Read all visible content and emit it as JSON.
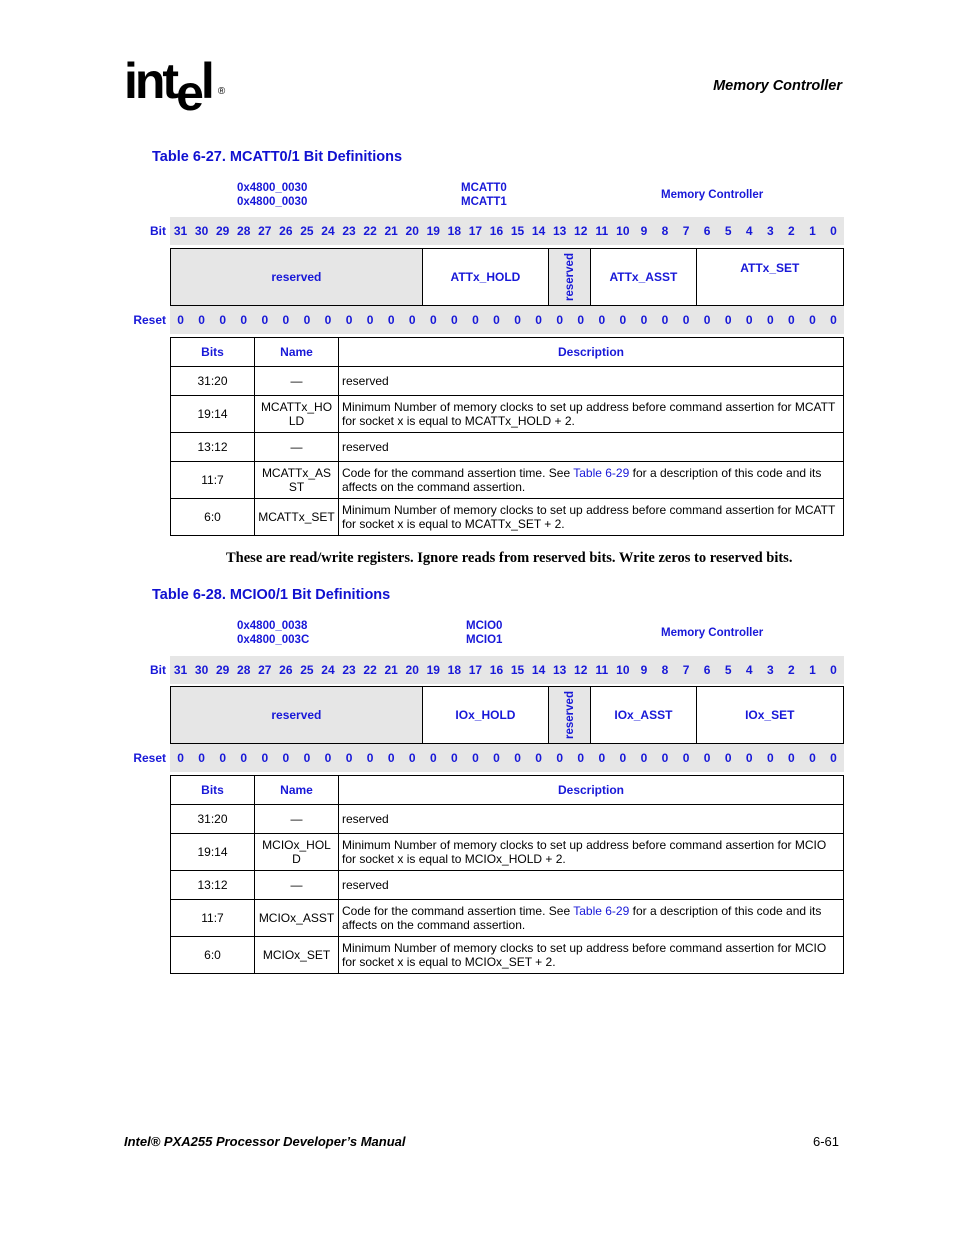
{
  "header": {
    "logo_text": "int",
    "logo_e": "e",
    "logo_l": "l",
    "logo_reg": "®",
    "section": "Memory Controller"
  },
  "tables": [
    {
      "title": "Table 6-27. MCATT0/1 Bit Definitions",
      "addresses": [
        "0x4800_0030",
        "0x4800_0030"
      ],
      "registers": [
        "MCATT0",
        "MCATT1"
      ],
      "unit": "Memory Controller",
      "bit_label": "Bit",
      "reset_label": "Reset",
      "bits": [
        "31",
        "30",
        "29",
        "28",
        "27",
        "26",
        "25",
        "24",
        "23",
        "22",
        "21",
        "20",
        "19",
        "18",
        "17",
        "16",
        "15",
        "14",
        "13",
        "12",
        "11",
        "10",
        "9",
        "8",
        "7",
        "6",
        "5",
        "4",
        "3",
        "2",
        "1",
        "0"
      ],
      "reset_values": [
        "0",
        "0",
        "0",
        "0",
        "0",
        "0",
        "0",
        "0",
        "0",
        "0",
        "0",
        "0",
        "0",
        "0",
        "0",
        "0",
        "0",
        "0",
        "0",
        "0",
        "0",
        "0",
        "0",
        "0",
        "0",
        "0",
        "0",
        "0",
        "0",
        "0",
        "0",
        "0"
      ],
      "fields": [
        {
          "label": "reserved",
          "bits": 12,
          "reserved": true,
          "vertical": false
        },
        {
          "label": "ATTx_HOLD",
          "bits": 6,
          "reserved": false,
          "vertical": false
        },
        {
          "label": "reserved",
          "bits": 2,
          "reserved": true,
          "vertical": true
        },
        {
          "label": "ATTx_ASST",
          "bits": 5,
          "reserved": false,
          "vertical": false
        },
        {
          "label": "ATTx_SET",
          "bits": 7,
          "reserved": false,
          "vertical": false
        }
      ],
      "columns": [
        "Bits",
        "Name",
        "Description"
      ],
      "rows": [
        {
          "bits": "31:20",
          "name": "—",
          "desc_pre": "reserved",
          "link": "",
          "desc_post": ""
        },
        {
          "bits": "19:14",
          "name": "MCATTx_HOLD",
          "desc_pre": "Minimum Number of memory clocks to set up address before command assertion for MCATT for socket x is equal to MCATTx_HOLD + 2.",
          "link": "",
          "desc_post": ""
        },
        {
          "bits": "13:12",
          "name": "—",
          "desc_pre": "reserved",
          "link": "",
          "desc_post": ""
        },
        {
          "bits": "11:7",
          "name": "MCATTx_ASST",
          "desc_pre": "Code for the command assertion time. See ",
          "link": "Table 6-29",
          "desc_post": " for a description of this code and its affects on the command assertion."
        },
        {
          "bits": "6:0",
          "name": "MCATTx_SET",
          "desc_pre": "Minimum Number of memory clocks to set up address before command assertion for MCATT for socket x is equal to MCATTx_SET + 2.",
          "link": "",
          "desc_post": ""
        }
      ]
    },
    {
      "title": "Table 6-28. MCIO0/1 Bit Definitions",
      "addresses": [
        "0x4800_0038",
        "0x4800_003C"
      ],
      "registers": [
        "MCIO0",
        "MCIO1"
      ],
      "unit": "Memory Controller",
      "bit_label": "Bit",
      "reset_label": "Reset",
      "bits": [
        "31",
        "30",
        "29",
        "28",
        "27",
        "26",
        "25",
        "24",
        "23",
        "22",
        "21",
        "20",
        "19",
        "18",
        "17",
        "16",
        "15",
        "14",
        "13",
        "12",
        "11",
        "10",
        "9",
        "8",
        "7",
        "6",
        "5",
        "4",
        "3",
        "2",
        "1",
        "0"
      ],
      "reset_values": [
        "0",
        "0",
        "0",
        "0",
        "0",
        "0",
        "0",
        "0",
        "0",
        "0",
        "0",
        "0",
        "0",
        "0",
        "0",
        "0",
        "0",
        "0",
        "0",
        "0",
        "0",
        "0",
        "0",
        "0",
        "0",
        "0",
        "0",
        "0",
        "0",
        "0",
        "0",
        "0"
      ],
      "fields": [
        {
          "label": "reserved",
          "bits": 12,
          "reserved": true,
          "vertical": false
        },
        {
          "label": "IOx_HOLD",
          "bits": 6,
          "reserved": false,
          "vertical": false
        },
        {
          "label": "reserved",
          "bits": 2,
          "reserved": true,
          "vertical": true
        },
        {
          "label": "IOx_ASST",
          "bits": 5,
          "reserved": false,
          "vertical": false
        },
        {
          "label": "IOx_SET",
          "bits": 7,
          "reserved": false,
          "vertical": false
        }
      ],
      "columns": [
        "Bits",
        "Name",
        "Description"
      ],
      "rows": [
        {
          "bits": "31:20",
          "name": "—",
          "desc_pre": "reserved",
          "link": "",
          "desc_post": ""
        },
        {
          "bits": "19:14",
          "name": "MCIOx_HOLD",
          "desc_pre": "Minimum Number of memory clocks to set up address before command assertion for MCIO for socket x is equal to MCIOx_HOLD + 2.",
          "link": "",
          "desc_post": ""
        },
        {
          "bits": "13:12",
          "name": "—",
          "desc_pre": "reserved",
          "link": "",
          "desc_post": ""
        },
        {
          "bits": "11:7",
          "name": "MCIOx_ASST",
          "desc_pre": "Code for the command assertion time. See ",
          "link": "Table 6-29",
          "desc_post": " for a description of this code and its affects on the command assertion."
        },
        {
          "bits": "6:0",
          "name": "MCIOx_SET",
          "desc_pre": "Minimum Number of memory clocks to set up address before command assertion for MCIO for socket x is equal to MCIOx_SET + 2.",
          "link": "",
          "desc_post": ""
        }
      ]
    }
  ],
  "note": "These are read/write registers. Ignore reads from reserved bits. Write zeros to reserved bits.",
  "footer": {
    "manual": "Intel® PXA255 Processor Developer’s Manual",
    "page": "6-61"
  }
}
